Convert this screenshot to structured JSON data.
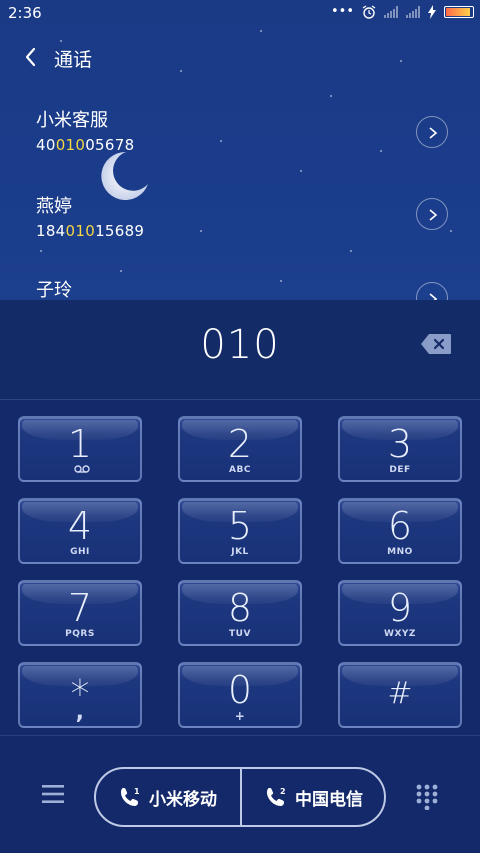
{
  "status_bar": {
    "time": "2:36",
    "icons": [
      "dots-icon",
      "alarm-icon",
      "signal-icon",
      "signal-icon",
      "charging-icon",
      "battery-icon"
    ]
  },
  "header": {
    "title": "通话",
    "back_icon": "back-chevron-icon"
  },
  "contacts": [
    {
      "name": "小米客服",
      "number_pre": "40",
      "number_match": "010",
      "number_post": "05678"
    },
    {
      "name": "燕婷",
      "number_pre": "184",
      "number_match": "010",
      "number_post": "15689"
    },
    {
      "name": "子玲",
      "number_pre": "",
      "number_match": "",
      "number_post": ""
    }
  ],
  "dial": {
    "entered": "010"
  },
  "keys": [
    {
      "digit": "1",
      "letters": ""
    },
    {
      "digit": "2",
      "letters": "ABC"
    },
    {
      "digit": "3",
      "letters": "DEF"
    },
    {
      "digit": "4",
      "letters": "GHI"
    },
    {
      "digit": "5",
      "letters": "JKL"
    },
    {
      "digit": "6",
      "letters": "MNO"
    },
    {
      "digit": "7",
      "letters": "PQRS"
    },
    {
      "digit": "8",
      "letters": "TUV"
    },
    {
      "digit": "9",
      "letters": "WXYZ"
    },
    {
      "digit": "*",
      "letters": ","
    },
    {
      "digit": "0",
      "letters": "+"
    },
    {
      "digit": "#",
      "letters": ""
    }
  ],
  "sim_buttons": [
    {
      "label": "小米移动",
      "sim": "1"
    },
    {
      "label": "中国电信",
      "sim": "2"
    }
  ],
  "colors": {
    "highlight": "#f4d542",
    "background": "#10255e"
  }
}
